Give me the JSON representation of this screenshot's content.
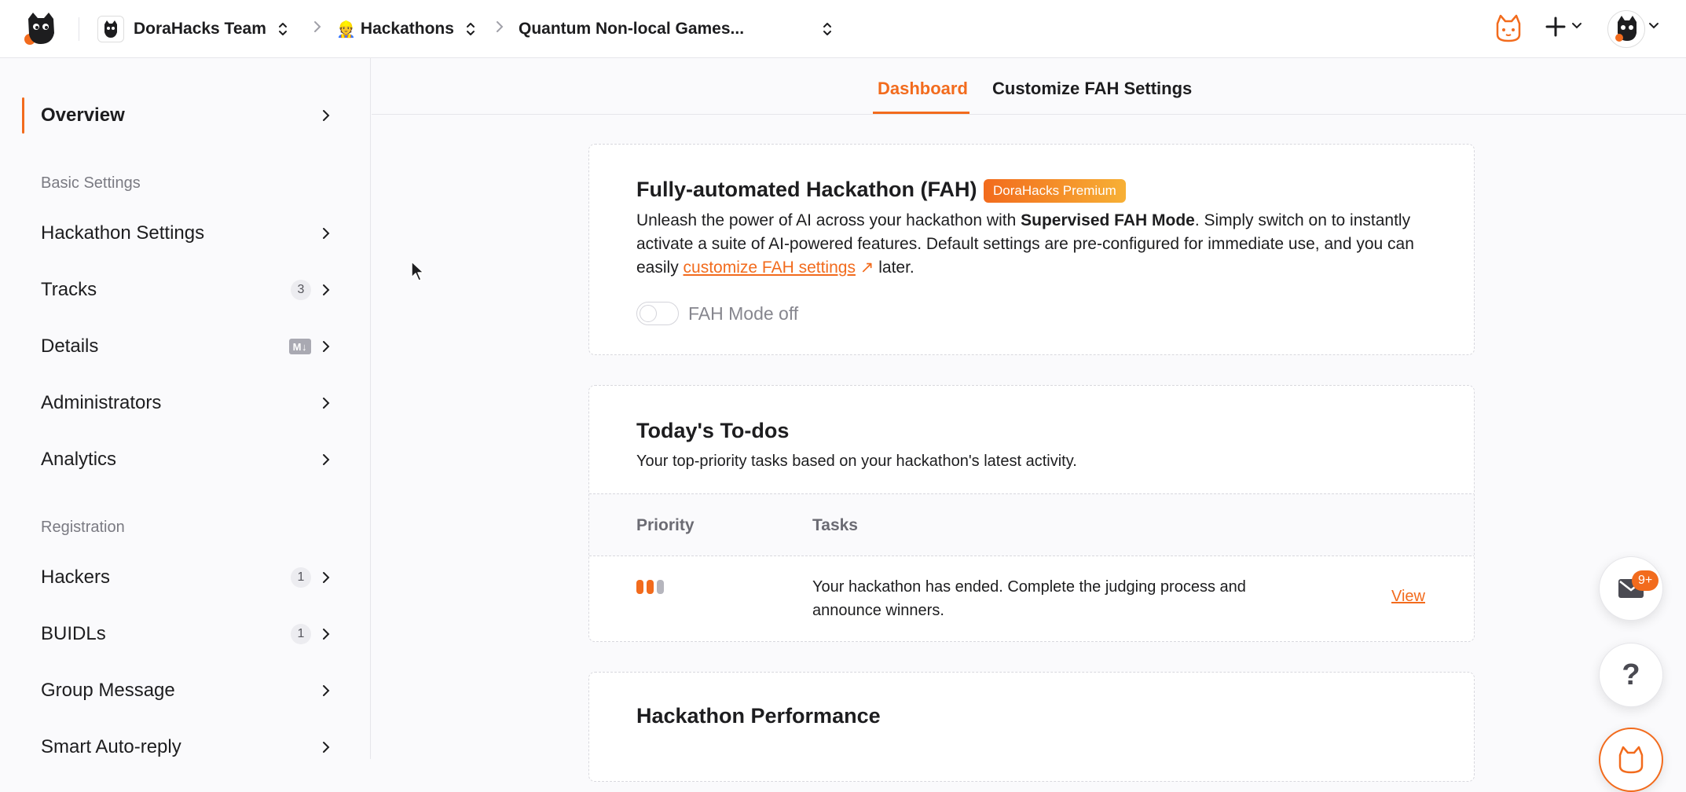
{
  "topbar": {
    "team_name": "DoraHacks Team",
    "section_name": "Hackathons",
    "hackathon_name": "Quantum Non-local Games..."
  },
  "sidebar": {
    "overview": "Overview",
    "basic_settings_label": "Basic Settings",
    "hackathon_settings": "Hackathon Settings",
    "tracks": "Tracks",
    "tracks_count": "3",
    "details": "Details",
    "details_badge": "M↓",
    "administrators": "Administrators",
    "analytics": "Analytics",
    "registration_label": "Registration",
    "hackers": "Hackers",
    "hackers_count": "1",
    "buidls": "BUIDLs",
    "buidls_count": "1",
    "group_message": "Group Message",
    "smart_auto_reply": "Smart Auto-reply"
  },
  "tabs": {
    "dashboard": "Dashboard",
    "customize": "Customize FAH Settings"
  },
  "fah_card": {
    "title": "Fully-automated Hackathon (FAH)",
    "badge": "DoraHacks Premium",
    "desc_1": "Unleash the power of AI across your hackathon with ",
    "desc_bold": "Supervised FAH Mode",
    "desc_2": ". Simply switch on to instantly activate a suite of AI-powered features. Default settings are pre-configured for immediate use, and you can easily ",
    "desc_link": "customize FAH settings",
    "desc_ext": "↗",
    "desc_3": " later.",
    "toggle_label": "FAH Mode off"
  },
  "todo_card": {
    "title": "Today's To-dos",
    "subtitle": "Your top-priority tasks based on your hackathon's latest activity.",
    "col_priority": "Priority",
    "col_tasks": "Tasks",
    "rows": [
      {
        "task": "Your hackathon has ended. Complete the judging process and announce winners.",
        "action": "View"
      }
    ]
  },
  "perf_card": {
    "title": "Hackathon Performance"
  },
  "floating": {
    "mail_badge": "9+",
    "help": "?"
  },
  "colors": {
    "accent": "#f26b1d",
    "accent_light": "#f7b035"
  }
}
